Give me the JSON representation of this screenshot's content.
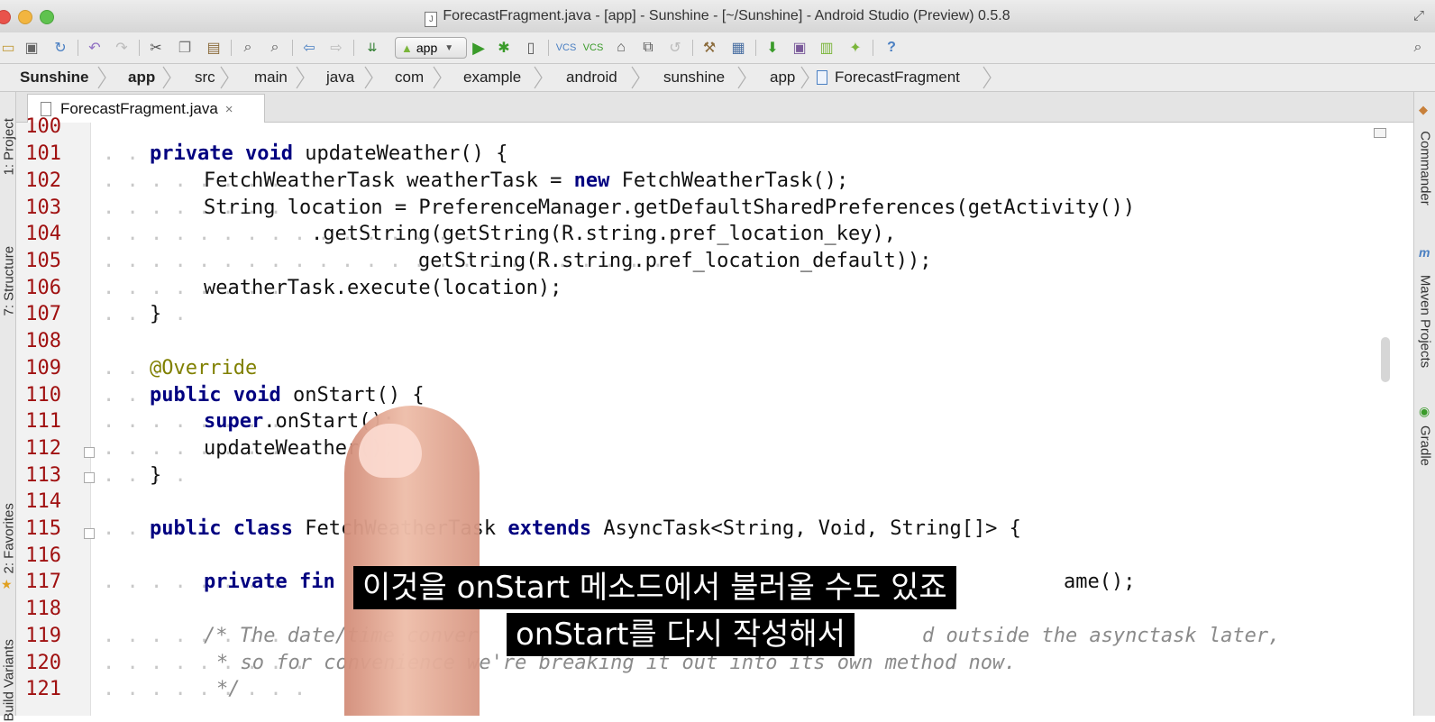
{
  "window": {
    "title": "ForecastFragment.java - [app] - Sunshine - [~/Sunshine] - Android Studio (Preview) 0.5.8"
  },
  "toolbar": {
    "run_config": "app",
    "icons": [
      "folder-icon",
      "save-icon",
      "sync-icon",
      "undo-icon",
      "redo-icon",
      "cut-icon",
      "copy-icon",
      "paste-icon",
      "find-icon",
      "replace-icon",
      "back-icon",
      "forward-icon",
      "make-project-icon",
      "run-icon",
      "debug-icon",
      "attach-debugger-icon",
      "vcs-update-icon",
      "vcs-commit-icon",
      "vcs-history-icon",
      "vcs-compare-icon",
      "revert-icon",
      "settings-icon",
      "project-structure-icon",
      "sdk-manager-icon",
      "avd-manager-icon",
      "monitor-icon",
      "android-icon",
      "help-icon"
    ]
  },
  "breadcrumbs": [
    "Sunshine",
    "app",
    "src",
    "main",
    "java",
    "com",
    "example",
    "android",
    "sunshine",
    "app",
    "ForecastFragment"
  ],
  "tab": {
    "label": "ForecastFragment.java",
    "close": "×"
  },
  "left_tool_windows": [
    "1: Project",
    "7: Structure",
    "2: Favorites",
    "Build Variants"
  ],
  "right_tool_windows": [
    "Commander",
    "Maven Projects",
    "Gradle"
  ],
  "editor": {
    "line_numbers": [
      "100",
      "101",
      "102",
      "103",
      "104",
      "105",
      "106",
      "107",
      "108",
      "109",
      "110",
      "111",
      "112",
      "113",
      "114",
      "115",
      "116",
      "117",
      "118",
      "119",
      "120",
      "121"
    ],
    "code": {
      "l100": "",
      "l101_kw": "private void",
      "l101_rest": " updateWeather() {",
      "l102_a": "FetchWeatherTask weatherTask = ",
      "l102_kw": "new",
      "l102_b": " FetchWeatherTask();",
      "l103": "String location = PreferenceManager.getDefaultSharedPreferences(getActivity())",
      "l104": ".getString(getString(R.string.pref_location_key),",
      "l105": "getString(R.string.pref_location_default));",
      "l106": "weatherTask.execute(location);",
      "l107": "}",
      "l109": "@Override",
      "l110_kw": "public void",
      "l110_rest": " onStart() {",
      "l111_kw": "super",
      "l111_rest": ".onStart();",
      "l112": "updateWeather();",
      "l113": "}",
      "l115_kw1": "public class",
      "l115_mid": " FetchWeatherTask ",
      "l115_kw2": "extends",
      "l115_rest": " AsyncTask<String, Void, String[]> {",
      "l117_kw": "private fin",
      "l117_rest": "ame();",
      "l119_a": "/* The date/time conver",
      "l119_b": "d outside the asynctask later,",
      "l120": "* so for convenience we're breaking it out into its own method now.",
      "l121": "*/"
    }
  },
  "subtitles": {
    "line1": "이것을 onStart 메소드에서 불러올 수도 있죠",
    "line2": "onStart를 다시 작성해서"
  },
  "colors": {
    "keyword": "#000080",
    "line_number": "#a01010",
    "annotation": "#808000",
    "comment": "#8a8a8a",
    "run_green": "#3a9b2a",
    "toolbar_bg": "#ececec"
  }
}
